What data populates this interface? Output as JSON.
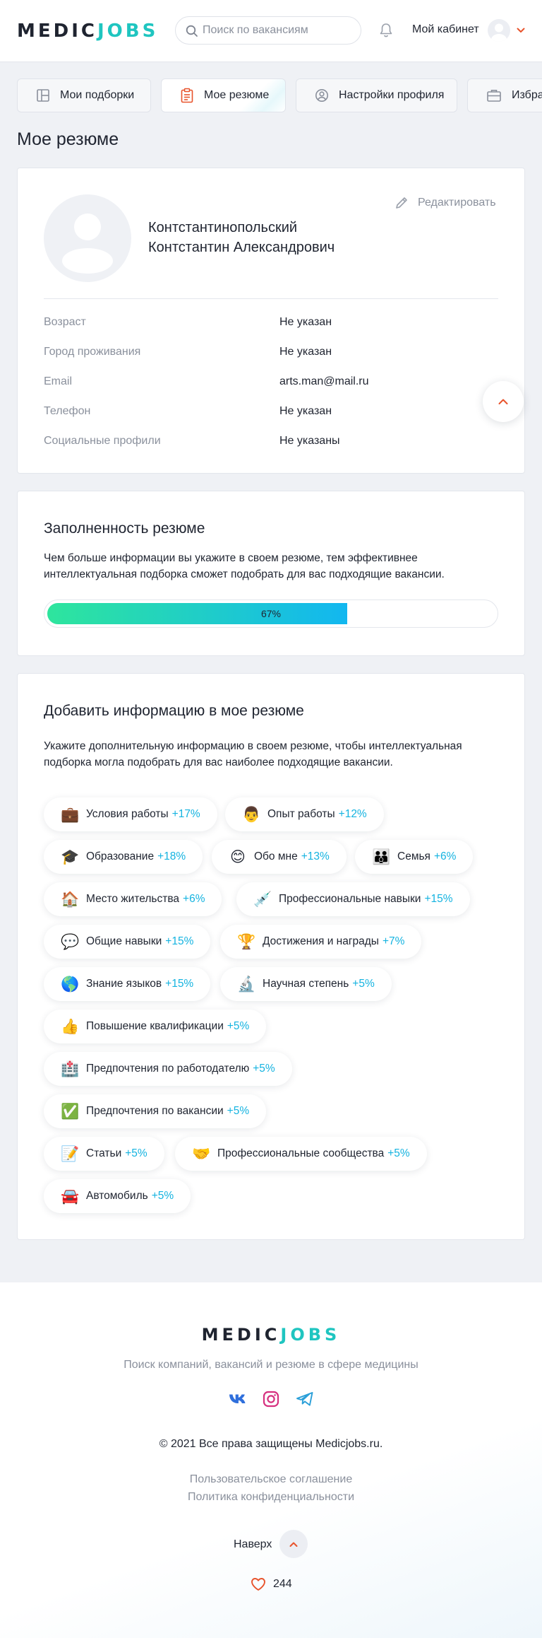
{
  "header": {
    "logo_part1": "MEDIC",
    "logo_part2": "JOBS",
    "search_placeholder": "Поиск по вакансиям",
    "cabinet_label": "Мой кабинет"
  },
  "tabs": [
    {
      "label": "Мои подборки",
      "icon": "layout-icon"
    },
    {
      "label": "Мое резюме",
      "icon": "clipboard-icon",
      "active": true
    },
    {
      "label": "Настройки профиля",
      "icon": "user-circle-icon"
    },
    {
      "label": "Избранное",
      "icon": "briefcase-icon"
    }
  ],
  "page_title": "Мое резюме",
  "profile": {
    "name_line1": "Контстантинопольский",
    "name_line2": "Контстантин Александрович",
    "edit_label": "Редактировать",
    "rows": [
      {
        "label": "Возраст",
        "value": "Не указан"
      },
      {
        "label": "Город проживания",
        "value": "Не указан"
      },
      {
        "label": "Email",
        "value": "arts.man@mail.ru"
      },
      {
        "label": "Телефон",
        "value": "Не указан"
      },
      {
        "label": "Социальные профили",
        "value": "Не указаны"
      }
    ]
  },
  "completeness": {
    "title": "Заполненность резюме",
    "text": "Чем больше информации вы укажите в своем резюме, тем эффективнее интеллектуальная подборка сможет подобрать для вас подходящие вакансии.",
    "percent": 67,
    "percent_label": "67%"
  },
  "add_info": {
    "title": "Добавить информацию в мое резюме",
    "text": "Укажите дополнительную информацию в своем резюме, чтобы интеллектуальная подборка могла подобрать для вас наиболее подходящие вакансии.",
    "chips": [
      {
        "emoji": "💼",
        "label": "Условия работы",
        "pct": "+17%"
      },
      {
        "emoji": "👨",
        "label": "Опыт работы",
        "pct": "+12%"
      },
      {
        "emoji": "🎓",
        "label": "Образование",
        "pct": "+18%"
      },
      {
        "emoji": "😊",
        "label": "Обо мне",
        "pct": "+13%"
      },
      {
        "emoji": "👪",
        "label": "Семья",
        "pct": "+6%"
      },
      {
        "emoji": "🏠",
        "label": "Место жительства",
        "pct": "+6%"
      },
      {
        "emoji": "💉",
        "label": "Профессиональные навыки",
        "pct": "+15%"
      },
      {
        "emoji": "💬",
        "label": "Общие навыки",
        "pct": "+15%"
      },
      {
        "emoji": "🏆",
        "label": "Достижения и награды",
        "pct": "+7%"
      },
      {
        "emoji": "🌎",
        "label": "Знание языков",
        "pct": "+15%"
      },
      {
        "emoji": "🔬",
        "label": "Научная степень",
        "pct": "+5%"
      },
      {
        "emoji": "👍",
        "label": "Повышение квалификации",
        "pct": "+5%"
      },
      {
        "emoji": "🏥",
        "label": "Предпочтения по работодателю",
        "pct": "+5%"
      },
      {
        "emoji": "✅",
        "label": "Предпочтения по вакансии",
        "pct": "+5%"
      },
      {
        "emoji": "📝",
        "label": "Статьи",
        "pct": "+5%"
      },
      {
        "emoji": "🤝",
        "label": "Профессиональные сообщества",
        "pct": "+5%"
      },
      {
        "emoji": "🚘",
        "label": "Автомобиль",
        "pct": "+5%"
      }
    ]
  },
  "footer": {
    "logo_part1": "MEDIC",
    "logo_part2": "JOBS",
    "subtitle": "Поиск компаний, вакансий и резюме в сфере медицины",
    "copyright": "© 2021 Все права защищены Medicjobs.ru.",
    "link1": "Пользовательское соглашение",
    "link2": "Политика конфиденциальности",
    "top_label": "Наверх",
    "likes": "244"
  },
  "colors": {
    "accent": "#1fc5c0",
    "link": "#14b3e0",
    "warn": "#e8532c"
  }
}
